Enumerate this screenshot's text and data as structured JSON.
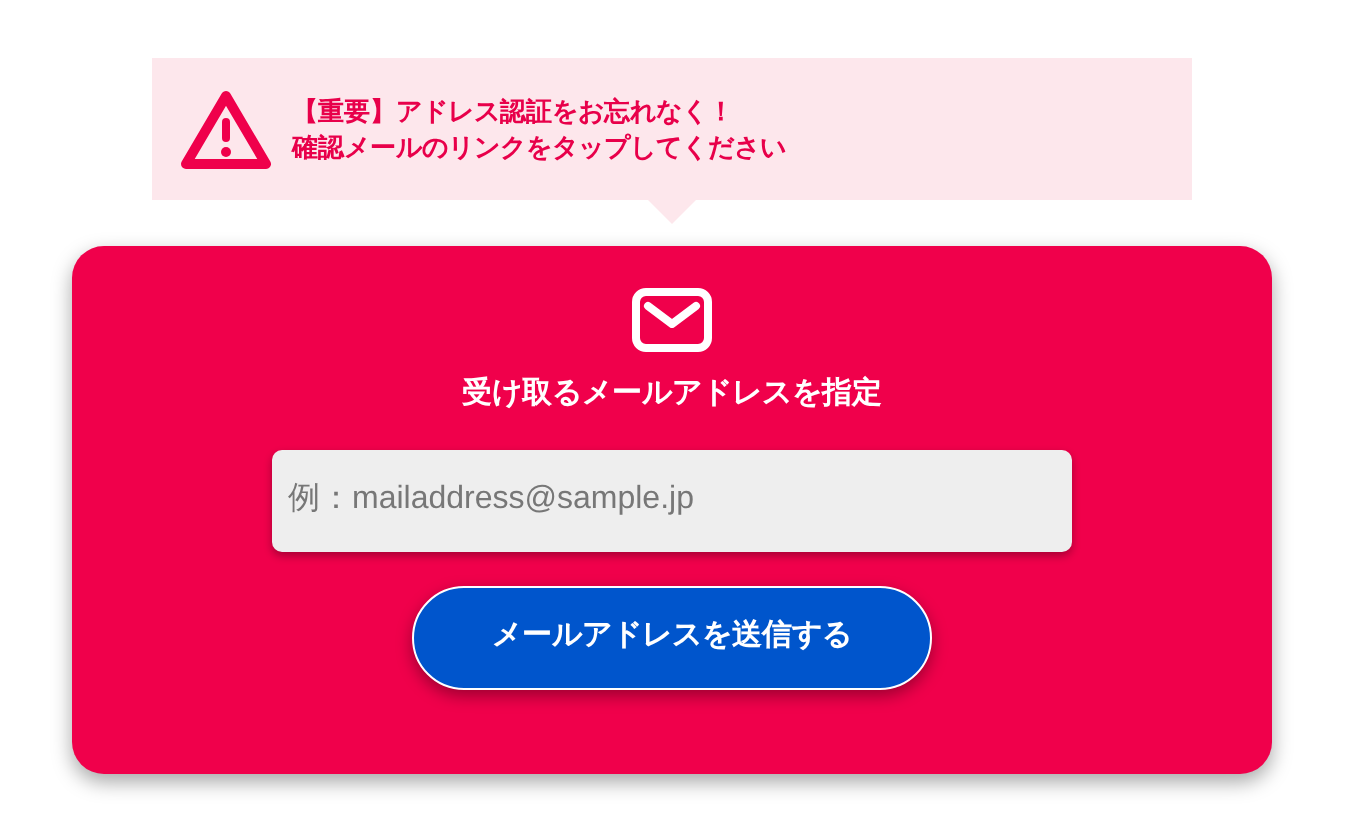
{
  "notice": {
    "lines": [
      "【重要】アドレス認証をお忘れなく！",
      "確認メールのリンクをタップしてください"
    ]
  },
  "card": {
    "title": "受け取るメールアドレスを指定",
    "email_field": {
      "placeholder": "例：mailaddress@sample.jp"
    },
    "submit_button": {
      "label": "メールアドレスを送信する"
    }
  }
}
